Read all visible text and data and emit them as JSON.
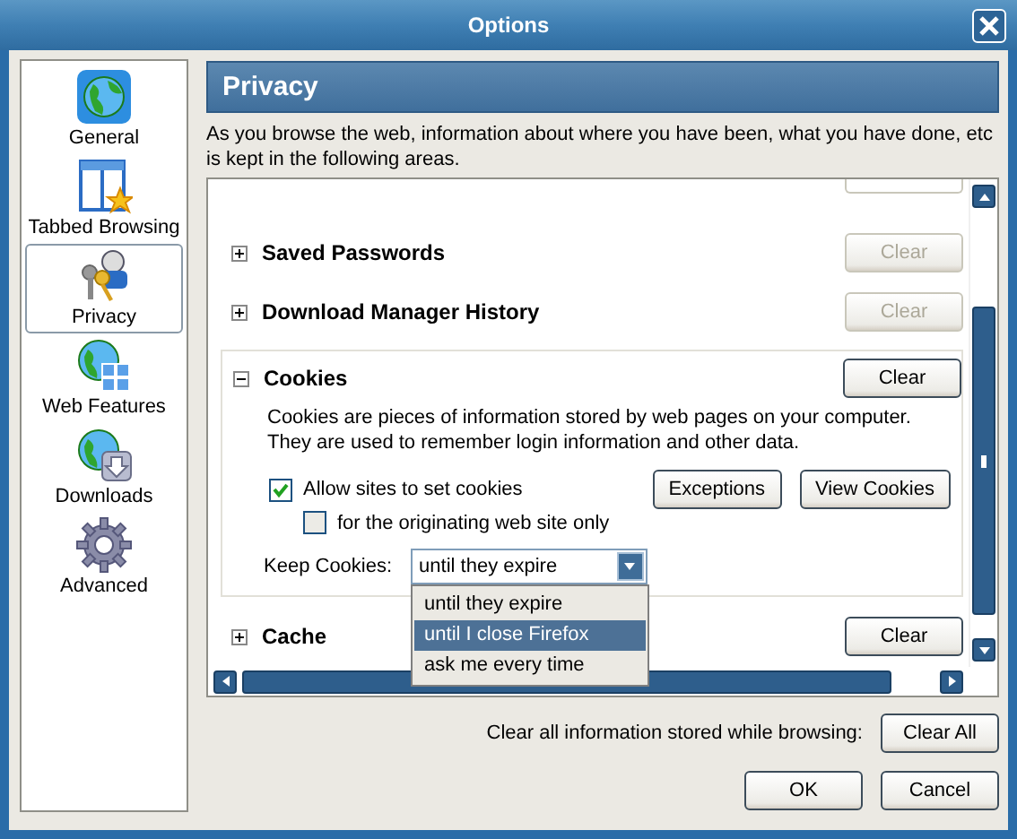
{
  "window": {
    "title": "Options"
  },
  "sidebar": {
    "items": [
      {
        "label": "General",
        "selected": false
      },
      {
        "label": "Tabbed Browsing",
        "selected": false
      },
      {
        "label": "Privacy",
        "selected": true
      },
      {
        "label": "Web Features",
        "selected": false
      },
      {
        "label": "Downloads",
        "selected": false
      },
      {
        "label": "Advanced",
        "selected": false
      }
    ]
  },
  "header": "Privacy",
  "description": "As you browse the web, information about where you have been, what you have done, etc is kept in the following areas.",
  "sections": [
    {
      "title": "Saved Passwords",
      "expanded": false,
      "button": {
        "label": "Clear",
        "disabled": true
      }
    },
    {
      "title": "Download Manager History",
      "expanded": false,
      "button": {
        "label": "Clear",
        "disabled": true
      }
    },
    {
      "title": "Cookies",
      "expanded": true,
      "button": {
        "label": "Clear",
        "disabled": false
      }
    },
    {
      "title": "Cache",
      "expanded": false,
      "button": {
        "label": "Clear",
        "disabled": false
      }
    }
  ],
  "cookies": {
    "description": "Cookies are pieces of information stored by web pages on your computer. They are used to remember login information and other data.",
    "allow": {
      "label": "Allow sites to set cookies",
      "checked": true
    },
    "originating": {
      "label": "for the originating web site only",
      "checked": false
    },
    "buttons": [
      "Exceptions",
      "View Cookies"
    ],
    "keep_label": "Keep Cookies:",
    "keep_value": "until they expire",
    "options": [
      {
        "label": "until they expire",
        "selected": false
      },
      {
        "label": "until I close Firefox",
        "selected": true
      },
      {
        "label": "ask me every time",
        "selected": false
      }
    ]
  },
  "footer": {
    "clear_all_label": "Clear all information stored while browsing:",
    "clear_all_button": "Clear All",
    "buttons": [
      "OK",
      "Cancel"
    ]
  }
}
